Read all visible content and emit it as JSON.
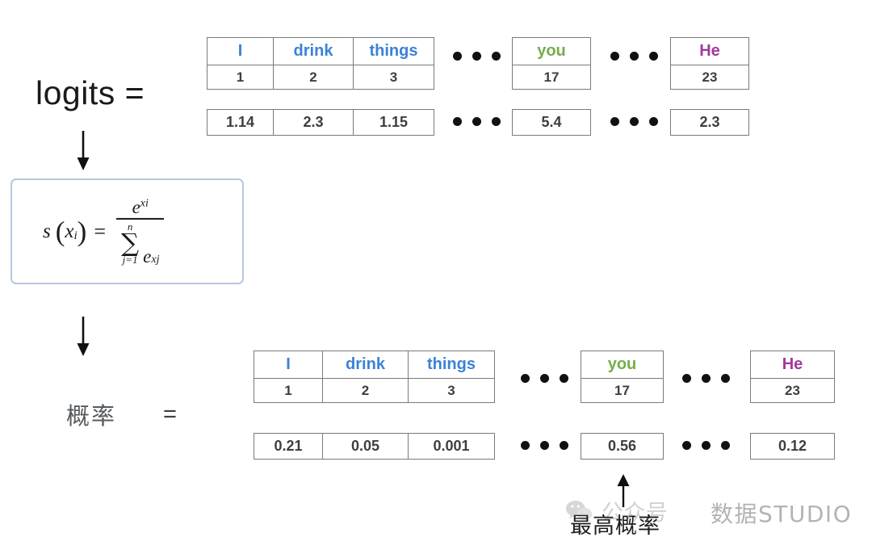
{
  "labels": {
    "logits": "logits =",
    "probability_cn": "概率",
    "probability_eq": "=",
    "highest_probability": "最高概率"
  },
  "formula": {
    "lhs_fn": "s",
    "lhs_open": "(",
    "lhs_var": "x",
    "lhs_sub": "i",
    "lhs_close": ")",
    "equals": "=",
    "numerator_base": "e",
    "numerator_exp": "xi",
    "sigma_top": "n",
    "sigma_glyph": "∑",
    "sigma_bottom": "j=1",
    "denominator_base": "e",
    "denominator_exp": "xj",
    "border_color": "#b9c5e4",
    "description": "softmax"
  },
  "colors": {
    "token_blue": "#3b82d6",
    "token_green": "#74ad4a",
    "token_purple": "#a03a9c",
    "number_gray": "#3e3e3e",
    "cell_border": "#7a7a7a",
    "formula_border": "#b9c5e4"
  },
  "logits_row": {
    "group_a": {
      "words": [
        "I",
        "drink",
        "things"
      ],
      "word_colors": [
        "#3b82d6",
        "#3b82d6",
        "#3b82d6"
      ],
      "indices": [
        "1",
        "2",
        "3"
      ],
      "values": [
        "1.14",
        "2.3",
        "1.15"
      ]
    },
    "group_b": {
      "words": [
        "you"
      ],
      "word_colors": [
        "#74ad4a"
      ],
      "indices": [
        "17"
      ],
      "values": [
        "5.4"
      ]
    },
    "group_c": {
      "words": [
        "He"
      ],
      "word_colors": [
        "#a03a9c"
      ],
      "indices": [
        "23"
      ],
      "values": [
        "2.3"
      ]
    },
    "ellipsis": "• • •"
  },
  "probs_row": {
    "group_a": {
      "words": [
        "I",
        "drink",
        "things"
      ],
      "word_colors": [
        "#3b82d6",
        "#3b82d6",
        "#3b82d6"
      ],
      "indices": [
        "1",
        "2",
        "3"
      ],
      "values": [
        "0.21",
        "0.05",
        "0.001"
      ]
    },
    "group_b": {
      "words": [
        "you"
      ],
      "word_colors": [
        "#74ad4a"
      ],
      "indices": [
        "17"
      ],
      "values": [
        "0.56"
      ]
    },
    "group_c": {
      "words": [
        "He"
      ],
      "word_colors": [
        "#a03a9c"
      ],
      "indices": [
        "23"
      ],
      "values": [
        "0.12"
      ]
    },
    "ellipsis": "• • •"
  },
  "watermark": {
    "icon": "wechat-icon",
    "account_label": "公众号",
    "brand": "数据STUDIO"
  },
  "arrows": {
    "down_1": "arrow-down",
    "down_2": "arrow-down",
    "up_highlight": "arrow-up"
  }
}
